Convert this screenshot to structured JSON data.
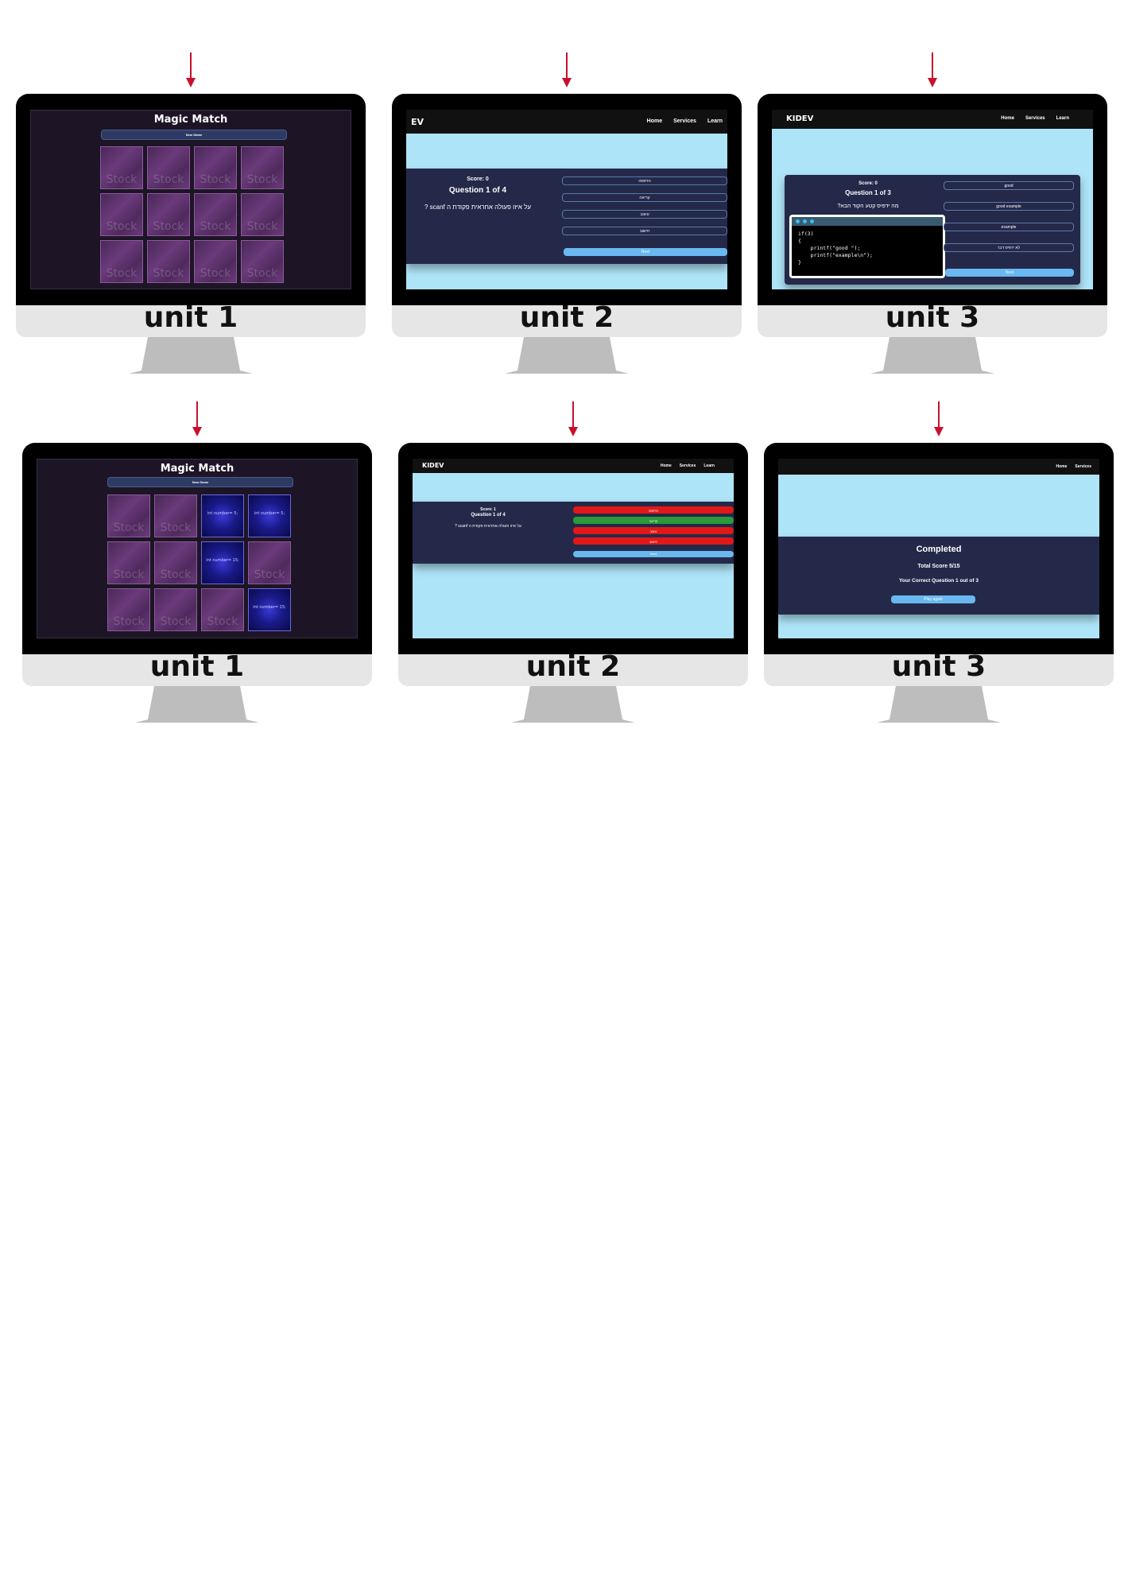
{
  "units": [
    {
      "label": "unit 1",
      "app": "magic-match",
      "title": "Magic Match",
      "new_game": "New Game",
      "cards": [
        {
          "text": "Stock"
        },
        {
          "text": "Stock"
        },
        {
          "text": "Stock"
        },
        {
          "text": "Stock"
        },
        {
          "text": "Stock"
        },
        {
          "text": "Stock"
        },
        {
          "text": "Stock"
        },
        {
          "text": "Stock"
        },
        {
          "text": "Stock"
        },
        {
          "text": "Stock"
        },
        {
          "text": "Stock"
        },
        {
          "text": "Stock"
        }
      ]
    },
    {
      "label": "unit 2",
      "logo": "EV",
      "nav": [
        "Home",
        "Services",
        "Learn"
      ],
      "score": "Score: 0",
      "question": "Question 1 of 4",
      "text": "על איזו פעולה אחראית פקודת ה scanf ?",
      "options": [
        "הדפסה",
        "קריאה",
        "עיצוב",
        "חישוב"
      ],
      "next": "Next"
    },
    {
      "label": "unit 3",
      "logo": "KIDEV",
      "nav": [
        "Home",
        "Services",
        "Learn"
      ],
      "score": "Score: 0",
      "question": "Question 1 of 3",
      "text": "מה ידפיס קטע הקוד הבא?",
      "code": "if(3)\n{\n    printf(\"good \");\n    printf(\"example\\n\");\n}",
      "options": [
        "good",
        "good example",
        "example",
        "לא ידפיס דבר"
      ],
      "next": "Next"
    },
    {
      "label": "unit 1",
      "app": "magic-match",
      "title": "Magic Match",
      "new_game": "New Game",
      "cards": [
        {
          "text": "Stock"
        },
        {
          "text": "Stock"
        },
        {
          "text": "int number= 5;",
          "open": true
        },
        {
          "text": "int number= 5;",
          "open": true
        },
        {
          "text": "Stock"
        },
        {
          "text": "Stock"
        },
        {
          "text": "int number= 15;",
          "open": true
        },
        {
          "text": "Stock"
        },
        {
          "text": "Stock"
        },
        {
          "text": "Stock"
        },
        {
          "text": "Stock"
        },
        {
          "text": "int number= 15;",
          "open": true
        }
      ]
    },
    {
      "label": "unit 2",
      "logo": "KIDEV",
      "nav": [
        "Home",
        "Services",
        "Learn"
      ],
      "score": "Score: 1",
      "question": "Question 1 of 4",
      "text": "על איזו פעולה אחראית פקודת ה scanf ?",
      "options": [
        "הדפסה",
        "קריאה",
        "עיצוב",
        "חישוב"
      ],
      "option_states": [
        "red",
        "green",
        "red",
        "red"
      ],
      "next": "Next"
    },
    {
      "label": "unit 3",
      "nav": [
        "Home",
        "Services"
      ],
      "completed": "Completed",
      "total": "Total Score 5/15",
      "correct": "Your Correct Question 1 out of 3",
      "play_again": "Play again"
    }
  ],
  "colors": {
    "arrow": "#c8102e",
    "quiz_bg": "#aee4f7",
    "panel": "#24294a",
    "next_btn": "#6ab8f0"
  }
}
